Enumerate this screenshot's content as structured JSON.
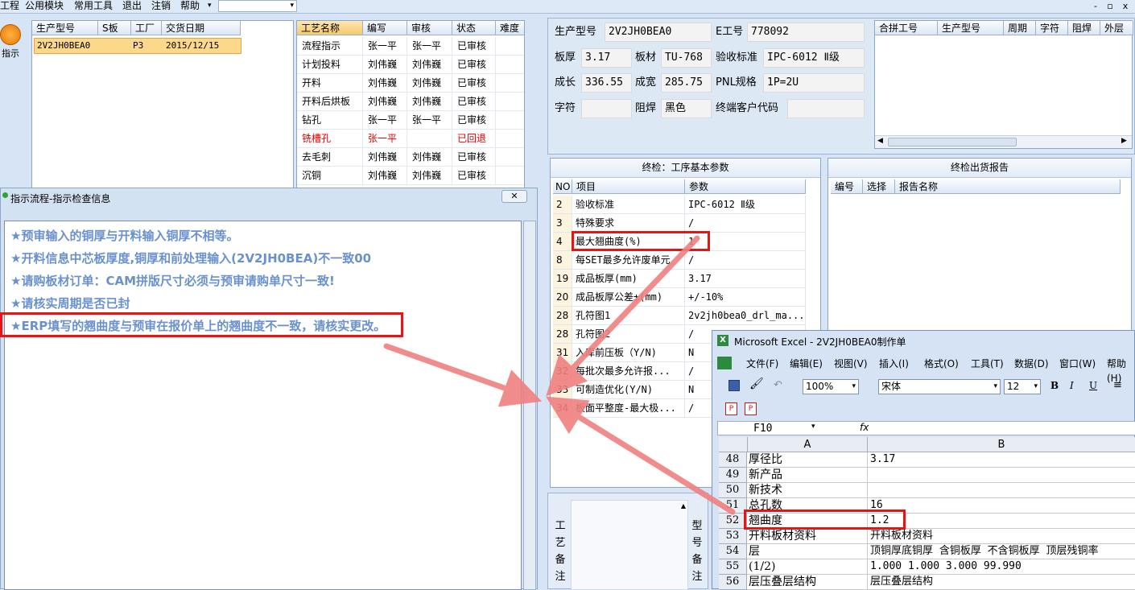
{
  "menu": [
    "工程",
    "公用模块",
    "常用工具",
    "退出",
    "注销",
    "帮助"
  ],
  "window_controls": [
    "-",
    "▫",
    "x"
  ],
  "left_button": {
    "label": "指示"
  },
  "order_table": {
    "headers": [
      "生产型号",
      "S板",
      "工厂",
      "交货日期"
    ],
    "rows": [
      [
        "2V2JH0BEA0",
        "",
        "P3",
        "2015/12/15"
      ]
    ]
  },
  "process_table": {
    "headers": [
      "工艺名称",
      "编写",
      "审核",
      "状态",
      "难度"
    ],
    "rows": [
      [
        "流程指示",
        "张一平",
        "张一平",
        "已审核",
        ""
      ],
      [
        "计划投料",
        "刘伟巍",
        "刘伟巍",
        "已审核",
        ""
      ],
      [
        "开料",
        "刘伟巍",
        "刘伟巍",
        "已审核",
        ""
      ],
      [
        "开料后烘板",
        "刘伟巍",
        "刘伟巍",
        "已审核",
        ""
      ],
      [
        "钻孔",
        "张一平",
        "张一平",
        "已审核",
        ""
      ],
      [
        "铣槽孔",
        "张一平",
        "",
        "已回退",
        ""
      ],
      [
        "去毛刺",
        "刘伟巍",
        "刘伟巍",
        "已审核",
        ""
      ],
      [
        "沉铜",
        "刘伟巍",
        "刘伟巍",
        "已审核",
        ""
      ]
    ]
  },
  "info": {
    "model_label": "生产型号",
    "model": "2V2JH0BEA0",
    "e_label": "E工号",
    "e_value": "778092",
    "thick_label": "板厚",
    "thick": "3.17",
    "material_label": "板材",
    "material": "TU-768",
    "std_label": "验收标准",
    "std": "IPC-6012 Ⅱ级",
    "len_label": "成长",
    "len": "336.55",
    "wid_label": "成宽",
    "wid": "285.75",
    "pnl_label": "PNL规格",
    "pnl": "1P=2U",
    "char_label": "字符",
    "char": "",
    "mask_label": "阻焊",
    "mask": "黑色",
    "cust_label": "终端客户代码",
    "cust": ""
  },
  "merge_table": {
    "headers": [
      "合拼工号",
      "生产型号",
      "周期",
      "字符",
      "阻焊",
      "外层"
    ]
  },
  "params": {
    "title": "终检：工序基本参数",
    "headers": [
      "NO",
      "项目",
      "参数"
    ],
    "rows": [
      [
        "2",
        "验收标准",
        "IPC-6012 Ⅱ级"
      ],
      [
        "3",
        "特殊要求",
        "/"
      ],
      [
        "4",
        "最大翘曲度(%)",
        "1"
      ],
      [
        "8",
        "每SET最多允许废单元",
        "/"
      ],
      [
        "19",
        "成品板厚(mm)",
        "3.17"
      ],
      [
        "20",
        "成品板厚公差±(mm)",
        "+/-10%"
      ],
      [
        "28",
        "孔符图1",
        "2v2jh0bea0_drl_ma..."
      ],
      [
        "28",
        "孔符图2",
        "/"
      ],
      [
        "31",
        "入库前压板（Y/N)",
        "N"
      ],
      [
        "32",
        "每批次最多允许报...",
        "/"
      ],
      [
        "33",
        "可制造优化(Y/N)",
        "N"
      ],
      [
        "34",
        "板面平整度-最大极...",
        "/"
      ]
    ]
  },
  "report": {
    "title": "终检出货报告",
    "headers": [
      "编号",
      "选择",
      "报告名称"
    ]
  },
  "remarks": {
    "process": "工艺备注",
    "model": "型号备注"
  },
  "msg": {
    "title": "指示流程-指示检查信息",
    "lines": [
      "★预审输入的铜厚与开料输入铜厚不相等。",
      "★开料信息中芯板厚度,铜厚和前处理输入(2V2JH0BEA)不一致00",
      "★请购板材订单：CAM拼版尺寸必须与预审请购单尺寸一致!",
      "★请核实周期是否已封",
      "★ERP填写的翘曲度与预审在报价单上的翘曲度不一致，请核实更改。"
    ]
  },
  "excel": {
    "title": "Microsoft Excel - 2V2JH0BEA0制作单",
    "menu": [
      "文件(F)",
      "编辑(E)",
      "视图(V)",
      "插入(I)",
      "格式(O)",
      "工具(T)",
      "数据(D)",
      "窗口(W)",
      "帮助(H)"
    ],
    "zoom": "100%",
    "font": "宋体",
    "size": "12",
    "cell_ref": "F10",
    "fx": "fx",
    "col_a": "A",
    "col_b": "B",
    "rows": [
      [
        "48",
        "厚径比",
        "3.17"
      ],
      [
        "49",
        "新产品",
        ""
      ],
      [
        "50",
        "新技术",
        ""
      ],
      [
        "51",
        "总孔数",
        "16"
      ],
      [
        "52",
        "翘曲度",
        "1.2"
      ],
      [
        "53",
        "开料板材资料",
        "开料板材资料"
      ],
      [
        "54",
        "层",
        "顶铜厚底铜厚 含铜板厚 不含铜板厚 顶层残铜率"
      ],
      [
        "55",
        "(1/2)",
        "1.000  1.000   3.000           99.990"
      ],
      [
        "56",
        "层压叠层结构",
        "层压叠层结构"
      ]
    ]
  },
  "colors": {
    "highlight": "#e81414",
    "message": "#6a91cf",
    "arrow": "#f08080"
  }
}
